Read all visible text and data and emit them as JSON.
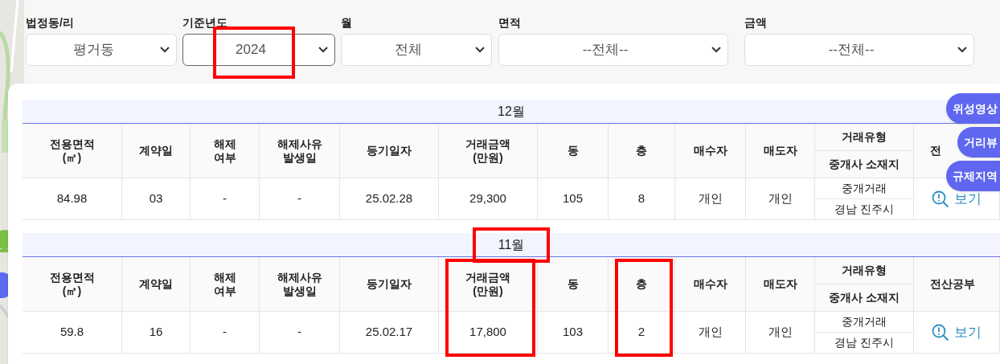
{
  "filters": [
    {
      "label": "법정동/리",
      "value": "평거동",
      "highlighted": false
    },
    {
      "label": "기준년도",
      "value": "2024",
      "highlighted": true
    },
    {
      "label": "월",
      "value": "전체",
      "highlighted": false
    },
    {
      "label": "면적",
      "value": "--전체--",
      "highlighted": false
    },
    {
      "label": "금액",
      "value": "--전체--",
      "highlighted": false
    }
  ],
  "sections": [
    {
      "month": "12월",
      "highlighted": false,
      "columns": [
        {
          "label": "전용면적\n(㎡)",
          "highlighted": false
        },
        {
          "label": "계약일",
          "highlighted": false
        },
        {
          "label": "해제\n여부",
          "highlighted": false
        },
        {
          "label": "해제사유\n발생일",
          "highlighted": false
        },
        {
          "label": "등기일자",
          "highlighted": false
        },
        {
          "label": "거래금액\n(만원)",
          "highlighted": false
        },
        {
          "label": "동",
          "highlighted": false
        },
        {
          "label": "층",
          "highlighted": false
        },
        {
          "label": "매수자",
          "highlighted": false
        },
        {
          "label": "매도자",
          "highlighted": false
        },
        {
          "label": "거래유형",
          "sublabel": "중개사 소재지",
          "highlighted": false
        },
        {
          "label": "전",
          "highlighted": false
        }
      ],
      "cells": [
        {
          "kind": "text",
          "text": "84.98"
        },
        {
          "kind": "text",
          "text": "03"
        },
        {
          "kind": "text",
          "text": "-"
        },
        {
          "kind": "text",
          "text": "-"
        },
        {
          "kind": "text",
          "text": "25.02.28"
        },
        {
          "kind": "text",
          "text": "29,300"
        },
        {
          "kind": "text",
          "text": "105"
        },
        {
          "kind": "text",
          "text": "8"
        },
        {
          "kind": "text",
          "text": "개인"
        },
        {
          "kind": "text",
          "text": "개인"
        },
        {
          "kind": "stacked",
          "lines": [
            "중개거래",
            "경남 진주시"
          ]
        },
        {
          "kind": "link",
          "text": "보기"
        }
      ]
    },
    {
      "month": "11월",
      "highlighted": true,
      "columns": [
        {
          "label": "전용면적\n(㎡)",
          "highlighted": false
        },
        {
          "label": "계약일",
          "highlighted": false
        },
        {
          "label": "해제\n여부",
          "highlighted": false
        },
        {
          "label": "해제사유\n발생일",
          "highlighted": false
        },
        {
          "label": "등기일자",
          "highlighted": false
        },
        {
          "label": "거래금액\n(만원)",
          "highlighted": true
        },
        {
          "label": "동",
          "highlighted": false
        },
        {
          "label": "층",
          "highlighted": true
        },
        {
          "label": "매수자",
          "highlighted": false
        },
        {
          "label": "매도자",
          "highlighted": false
        },
        {
          "label": "거래유형",
          "sublabel": "중개사 소재지",
          "highlighted": false
        },
        {
          "label": "전산공부",
          "highlighted": false
        }
      ],
      "cells": [
        {
          "kind": "text",
          "text": "59.8"
        },
        {
          "kind": "text",
          "text": "16"
        },
        {
          "kind": "text",
          "text": "-"
        },
        {
          "kind": "text",
          "text": "-"
        },
        {
          "kind": "text",
          "text": "25.02.17"
        },
        {
          "kind": "text",
          "text": "17,800"
        },
        {
          "kind": "text",
          "text": "103"
        },
        {
          "kind": "text",
          "text": "2"
        },
        {
          "kind": "text",
          "text": "개인"
        },
        {
          "kind": "text",
          "text": "개인"
        },
        {
          "kind": "stacked",
          "lines": [
            "중개거래",
            "경남 진주시"
          ]
        },
        {
          "kind": "link",
          "text": "보기"
        }
      ]
    }
  ],
  "side_buttons": [
    "위성영상",
    "거리뷰",
    "규제지역"
  ]
}
